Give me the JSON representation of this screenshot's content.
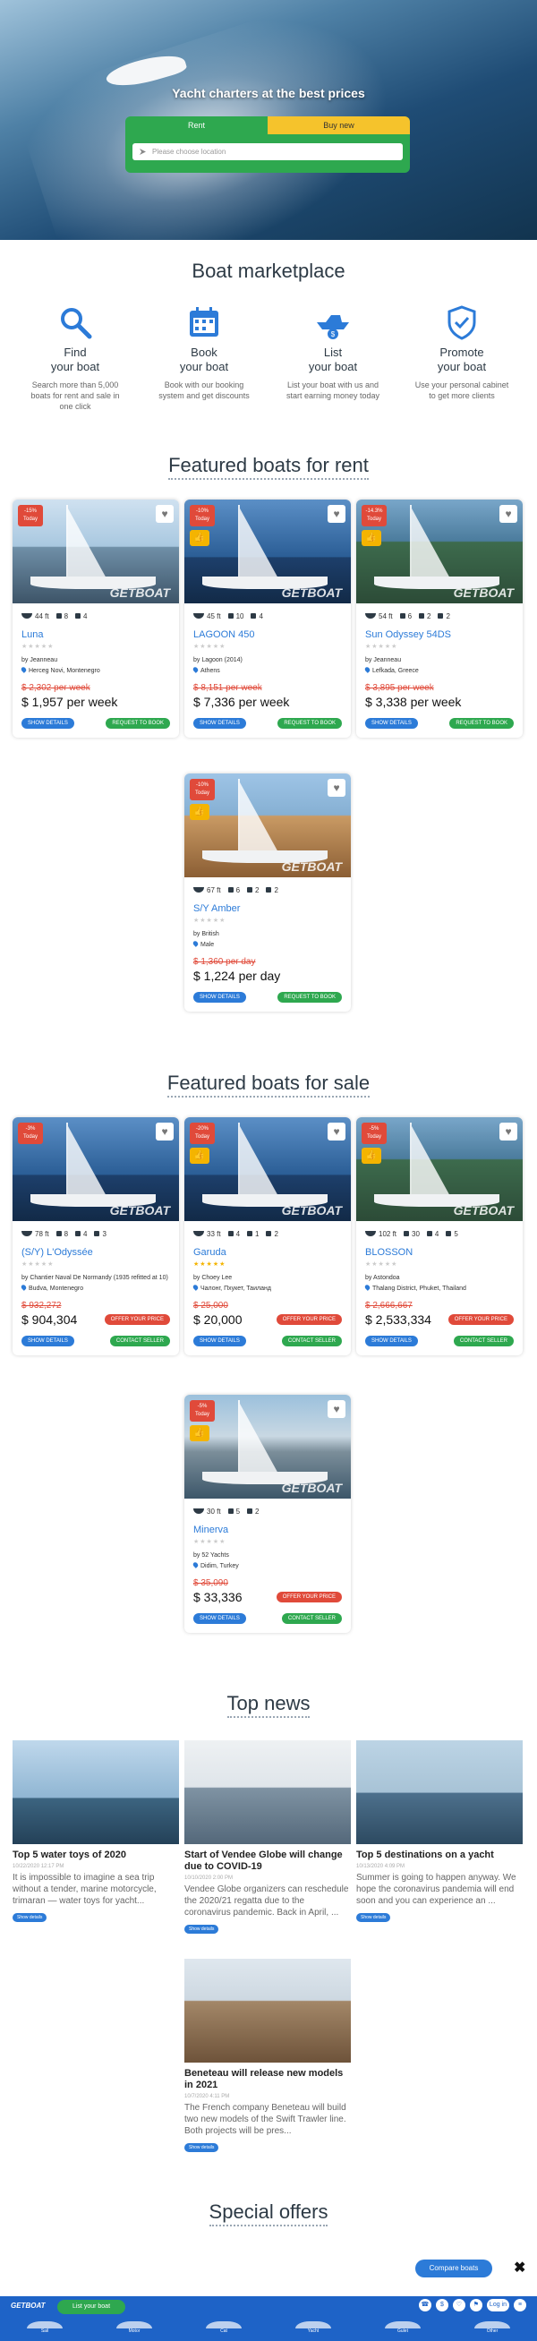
{
  "hero": {
    "title": "Yacht charters at the best prices",
    "tab_rent": "Rent",
    "tab_buy": "Buy new",
    "location_placeholder": "Please choose location"
  },
  "marketplace": {
    "title": "Boat marketplace",
    "features": [
      {
        "icon": "search-icon",
        "title1": "Find",
        "title2": "your boat",
        "desc": "Search more than 5,000 boats for rent and sale in one click"
      },
      {
        "icon": "calendar-icon",
        "title1": "Book",
        "title2": "your boat",
        "desc": "Book with our booking system and get discounts"
      },
      {
        "icon": "boat-coin-icon",
        "title1": "List",
        "title2": "your boat",
        "desc": "List your boat with us and start earning money today"
      },
      {
        "icon": "shield-check-icon",
        "title1": "Promote",
        "title2": "your boat",
        "desc": "Use your personal cabinet to get more clients"
      }
    ]
  },
  "rent": {
    "title": "Featured boats for rent",
    "boats": [
      {
        "discount": "-15%",
        "tag": "Today",
        "length": "44 ft",
        "cabins": "8",
        "berths": "4",
        "guests": "",
        "name": "Luna",
        "by": "by Jeanneau",
        "place": "Herceg Novi, Montenegro",
        "old": "$ 2,302 per week",
        "price": "$ 1,957 per week",
        "b1": "Show details",
        "b2": "Request to book"
      },
      {
        "discount": "-10%",
        "tag": "Today",
        "length": "45 ft",
        "cabins": "10",
        "berths": "4",
        "guests": "",
        "name": "LAGOON 450",
        "by": "by Lagoon (2014)",
        "place": "Athens",
        "old": "$ 8,151 per week",
        "price": "$ 7,336 per week",
        "b1": "Show details",
        "b2": "Request to book"
      },
      {
        "discount": "-14.3%",
        "tag": "Today",
        "length": "54 ft",
        "cabins": "6",
        "berths": "2",
        "guests": "2",
        "name": "Sun Odyssey 54DS",
        "by": "by Jeanneau",
        "place": "Lefkada, Greece",
        "old": "$ 3,895 per week",
        "price": "$ 3,338 per week",
        "b1": "Show details",
        "b2": "Request to book"
      },
      {
        "discount": "-10%",
        "tag": "Today",
        "length": "67 ft",
        "cabins": "6",
        "berths": "2",
        "guests": "2",
        "name": "S/Y Amber",
        "by": "by British",
        "place": "Male",
        "old": "$ 1,360 per day",
        "price": "$ 1,224 per day",
        "b1": "Show details",
        "b2": "Request to book"
      }
    ]
  },
  "sale": {
    "title": "Featured boats for sale",
    "boats": [
      {
        "discount": "-3%",
        "tag": "Today",
        "length": "78 ft",
        "cabins": "8",
        "berths": "4",
        "guests": "3",
        "name": "(S/Y) L'Odyssée",
        "by": "by Chantier Naval De Normandy (1935 refitted at 10)",
        "place": "Budva, Montenegro",
        "old": "$ 932,272",
        "price": "$ 904,304",
        "offer": "Offer your price",
        "b1": "Show details",
        "b2": "Contact seller"
      },
      {
        "discount": "-20%",
        "tag": "Today",
        "length": "33 ft",
        "cabins": "4",
        "berths": "1",
        "guests": "2",
        "name": "Garuda",
        "by": "by Choey Lee",
        "place": "Чалонг, Пхукет, Таиланд",
        "old": "$ 25,000",
        "price": "$ 20,000",
        "offer": "Offer your price",
        "b1": "Show details",
        "b2": "Contact seller"
      },
      {
        "discount": "-5%",
        "tag": "Today",
        "length": "102 ft",
        "cabins": "30",
        "berths": "4",
        "guests": "5",
        "name": "BLOSSON",
        "by": "by Astondoa",
        "place": "Thalang District, Phuket, Thailand",
        "old": "$ 2,666,667",
        "price": "$ 2,533,334",
        "offer": "Offer your price",
        "b1": "Show details",
        "b2": "Contact seller"
      },
      {
        "discount": "-5%",
        "tag": "Today",
        "length": "30 ft",
        "cabins": "5",
        "berths": "2",
        "guests": "",
        "name": "Minerva",
        "by": "by 52 Yachts",
        "place": "Didim, Turkey",
        "old": "$ 35,090",
        "price": "$ 33,336",
        "offer": "Offer your price",
        "b1": "Show details",
        "b2": "Contact seller"
      }
    ]
  },
  "news": {
    "title": "Top news",
    "items": [
      {
        "title": "Top 5 water toys of 2020",
        "date": "10/22/2020 12:17 PM",
        "text": "It is impossible to imagine a sea trip without a tender, marine motorcycle, trimaran — water toys for yacht...",
        "more": "Show details"
      },
      {
        "title": "Start of Vendee Globe will change due to COVID-19",
        "date": "10/10/2020 2:00 PM",
        "text": "Vendee Globe organizers can reschedule the 2020/21 regatta due to the coronavirus pandemic. Back in April, ...",
        "more": "Show details"
      },
      {
        "title": "Top 5 destinations on a yacht",
        "date": "10/13/2020 4:09 PM",
        "text": "Summer is going to happen anyway. We hope the coronavirus pandemia will end soon and you can experience an ...",
        "more": "Show details"
      },
      {
        "title": "Beneteau will release new models in 2021",
        "date": "10/7/2020 4:11 PM",
        "text": "The French company Beneteau will build two new models of the Swift Trawler line. Both projects will be pres...",
        "more": "Show details"
      }
    ]
  },
  "offers": {
    "title": "Special offers"
  },
  "compare": {
    "label": "Compare boats",
    "close": "✖"
  },
  "footer": {
    "logo": "GETBOAT",
    "list_button": "List your boat",
    "login": "Log in",
    "cats": [
      "Sail",
      "Motor",
      "Cat",
      "Yacht",
      "Gulet",
      "Other"
    ]
  },
  "watermark": "GETBOAT"
}
